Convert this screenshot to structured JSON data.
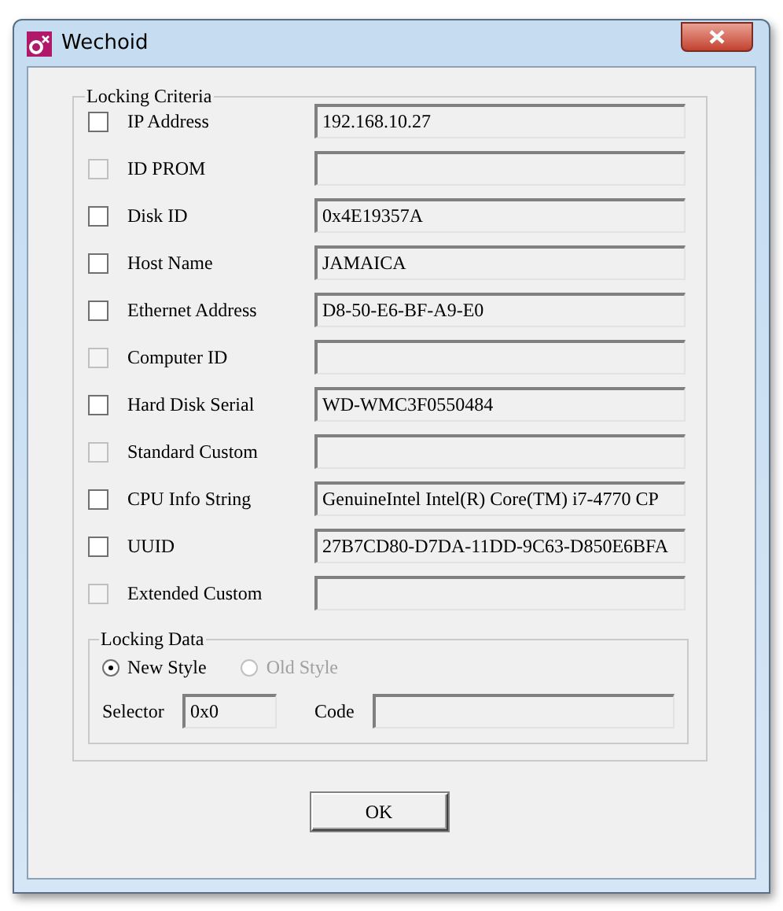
{
  "window": {
    "title": "Wechoid"
  },
  "locking_criteria": {
    "title": "Locking Criteria",
    "rows": [
      {
        "label": "IP Address",
        "checked": false,
        "disabled": false,
        "value": "192.168.10.27"
      },
      {
        "label": "ID PROM",
        "checked": false,
        "disabled": true
      },
      {
        "label": "Disk ID",
        "checked": false,
        "disabled": false,
        "value": "0x4E19357A"
      },
      {
        "label": "Host Name",
        "checked": false,
        "disabled": false,
        "value": "JAMAICA"
      },
      {
        "label": "Ethernet Address",
        "checked": false,
        "disabled": false,
        "value": "D8-50-E6-BF-A9-E0"
      },
      {
        "label": "Computer ID",
        "checked": false,
        "disabled": true
      },
      {
        "label": "Hard Disk Serial",
        "checked": false,
        "disabled": false,
        "value": "WD-WMC3F0550484"
      },
      {
        "label": "Standard Custom",
        "checked": false,
        "disabled": true
      },
      {
        "label": "CPU Info String",
        "checked": false,
        "disabled": false,
        "value": "GenuineIntel Intel(R) Core(TM) i7-4770 CP"
      },
      {
        "label": "UUID",
        "checked": false,
        "disabled": false,
        "value": "27B7CD80-D7DA-11DD-9C63-D850E6BFA"
      },
      {
        "label": "Extended Custom",
        "checked": false,
        "disabled": true
      }
    ]
  },
  "locking_data": {
    "title": "Locking Data",
    "styles": [
      {
        "label": "New Style",
        "selected": true,
        "disabled": false
      },
      {
        "label": "Old Style",
        "selected": false,
        "disabled": true
      }
    ],
    "selector": {
      "label": "Selector",
      "value": "0x0"
    },
    "code": {
      "label": "Code"
    }
  },
  "buttons": [
    "OK"
  ]
}
